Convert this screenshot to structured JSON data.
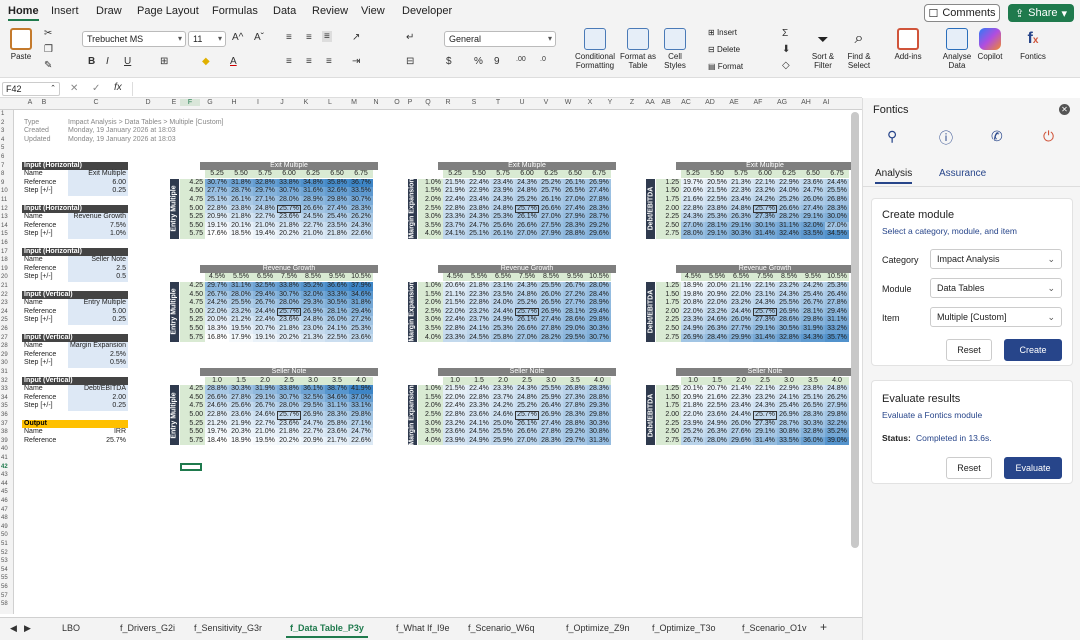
{
  "menu": {
    "tabs": [
      "Home",
      "Insert",
      "Draw",
      "Page Layout",
      "Formulas",
      "Data",
      "Review",
      "View",
      "Developer"
    ],
    "comments": "Comments",
    "share": "Share"
  },
  "ribbon": {
    "paste": "Paste",
    "font_name": "Trebuchet MS",
    "font_size": "11",
    "number_format": "General",
    "cond_fmt": "Conditional Formatting",
    "format_table": "Format as Table",
    "cell_styles": "Cell Styles",
    "insert": "Insert",
    "delete": "Delete",
    "format": "Format",
    "sort_filter": "Sort & Filter",
    "find_select": "Find & Select",
    "addins": "Add-ins",
    "analyse": "Analyse Data",
    "copilot": "Copilot",
    "fontics": "Fontics"
  },
  "formula_bar": {
    "name_box": "F42",
    "fx": "fx",
    "formula": ""
  },
  "columns": [
    "A",
    "B",
    "C",
    "D",
    "E",
    "F",
    "G",
    "H",
    "I",
    "J",
    "K",
    "L",
    "M",
    "N",
    "O",
    "P",
    "Q",
    "R",
    "S",
    "T",
    "U",
    "V",
    "W",
    "X",
    "Y",
    "Z",
    "AA",
    "AB",
    "AC",
    "AD",
    "AE",
    "AF",
    "AG",
    "AH",
    "AI"
  ],
  "meta": [
    {
      "label": "Type",
      "value": "Impact Analysis > Data Tables > Multiple [Custom]"
    },
    {
      "label": "Created",
      "value": "Monday, 19 January 2026 at 18:03"
    },
    {
      "label": "Updated",
      "value": "Monday, 19 January 2026 at 18:03"
    }
  ],
  "inputs": [
    {
      "header": "Input (Horizontal)",
      "rows": [
        [
          "Name",
          "Exit Multiple"
        ],
        [
          "Reference",
          "6.00"
        ],
        [
          "Step [+/-]",
          "0.25"
        ]
      ]
    },
    {
      "header": "Input (Horizontal)",
      "rows": [
        [
          "Name",
          "Revenue Growth"
        ],
        [
          "Reference",
          "7.5%"
        ],
        [
          "Step [+/-]",
          "1.0%"
        ]
      ]
    },
    {
      "header": "Input (Horizontal)",
      "rows": [
        [
          "Name",
          "Seller Note"
        ],
        [
          "Reference",
          "2.5"
        ],
        [
          "Step [+/-]",
          "0.5"
        ]
      ]
    },
    {
      "header": "Input (Vertical)",
      "rows": [
        [
          "Name",
          "Entry Multiple"
        ],
        [
          "Reference",
          "5.00"
        ],
        [
          "Step [+/-]",
          "0.25"
        ]
      ]
    },
    {
      "header": "Input (Vertical)",
      "rows": [
        [
          "Name",
          "Margin Expansion"
        ],
        [
          "Reference",
          "2.5%"
        ],
        [
          "Step [+/-]",
          "0.5%"
        ]
      ]
    },
    {
      "header": "Input (Vertical)",
      "rows": [
        [
          "Name",
          "Debt/EBITDA"
        ],
        [
          "Reference",
          "2.00"
        ],
        [
          "Step [+/-]",
          "0.25"
        ]
      ]
    }
  ],
  "output": {
    "header": "Output",
    "rows": [
      [
        "Name",
        "IRR"
      ],
      [
        "Reference",
        "25.7%"
      ]
    ]
  },
  "table_groups": [
    {
      "title": "Exit Multiple",
      "cols": [
        "5.25",
        "5.50",
        "5.75",
        "6.00",
        "6.25",
        "6.50",
        "6.75"
      ]
    },
    {
      "title": "Revenue Growth",
      "cols": [
        "4.5%",
        "5.5%",
        "6.5%",
        "7.5%",
        "8.5%",
        "9.5%",
        "10.5%"
      ]
    },
    {
      "title": "Seller Note",
      "cols": [
        "1.0",
        "1.5",
        "2.0",
        "2.5",
        "3.0",
        "3.5",
        "4.0"
      ]
    }
  ],
  "row_inputs": [
    {
      "label": "Entry Multiple",
      "rows": [
        "4.25",
        "4.50",
        "4.75",
        "5.00",
        "5.25",
        "5.50",
        "5.75"
      ]
    },
    {
      "label": "Margin Expansion",
      "rows": [
        "1.0%",
        "1.5%",
        "2.0%",
        "2.5%",
        "3.0%",
        "3.5%",
        "4.0%"
      ]
    },
    {
      "label": "Debt/EBITDA",
      "rows": [
        "1.25",
        "1.50",
        "1.75",
        "2.00",
        "2.25",
        "2.50",
        "2.75"
      ]
    }
  ],
  "tables": [
    [
      [
        [
          "30.7%",
          "31.8%",
          "32.8%",
          "33.8%",
          "34.8%",
          "35.8%",
          "36.7%"
        ],
        [
          "27.7%",
          "28.7%",
          "29.7%",
          "30.7%",
          "31.6%",
          "32.6%",
          "33.5%"
        ],
        [
          "25.1%",
          "26.1%",
          "27.1%",
          "28.0%",
          "28.9%",
          "29.8%",
          "30.7%"
        ],
        [
          "22.8%",
          "23.8%",
          "24.8%",
          "25.7%",
          "26.6%",
          "27.4%",
          "28.3%"
        ],
        [
          "20.9%",
          "21.8%",
          "22.7%",
          "23.6%",
          "24.5%",
          "25.4%",
          "26.2%"
        ],
        [
          "19.1%",
          "20.1%",
          "21.0%",
          "21.8%",
          "22.7%",
          "23.5%",
          "24.3%"
        ],
        [
          "17.6%",
          "18.5%",
          "19.4%",
          "20.2%",
          "21.0%",
          "21.8%",
          "22.6%"
        ]
      ],
      [
        [
          "21.5%",
          "22.4%",
          "23.4%",
          "24.3%",
          "25.2%",
          "26.1%",
          "26.9%"
        ],
        [
          "21.9%",
          "22.9%",
          "23.9%",
          "24.8%",
          "25.7%",
          "26.5%",
          "27.4%"
        ],
        [
          "22.4%",
          "23.4%",
          "24.3%",
          "25.2%",
          "26.1%",
          "27.0%",
          "27.8%"
        ],
        [
          "22.8%",
          "23.8%",
          "24.8%",
          "25.7%",
          "26.6%",
          "27.4%",
          "28.3%"
        ],
        [
          "23.3%",
          "24.3%",
          "25.3%",
          "26.1%",
          "27.0%",
          "27.9%",
          "28.7%"
        ],
        [
          "23.7%",
          "24.7%",
          "25.6%",
          "26.6%",
          "27.5%",
          "28.3%",
          "29.2%"
        ],
        [
          "24.1%",
          "25.1%",
          "26.1%",
          "27.0%",
          "27.9%",
          "28.8%",
          "29.6%"
        ]
      ],
      [
        [
          "19.7%",
          "20.5%",
          "21.3%",
          "22.1%",
          "22.9%",
          "23.6%",
          "24.4%"
        ],
        [
          "20.6%",
          "21.5%",
          "22.3%",
          "23.2%",
          "24.0%",
          "24.7%",
          "25.5%"
        ],
        [
          "21.6%",
          "22.5%",
          "23.4%",
          "24.2%",
          "25.2%",
          "26.0%",
          "26.8%"
        ],
        [
          "22.8%",
          "23.8%",
          "24.8%",
          "25.7%",
          "26.6%",
          "27.4%",
          "28.3%"
        ],
        [
          "24.3%",
          "25.3%",
          "26.3%",
          "27.3%",
          "28.2%",
          "29.1%",
          "30.0%"
        ],
        [
          "27.0%",
          "28.1%",
          "29.1%",
          "30.1%",
          "31.1%",
          "32.0%",
          "27.0%"
        ],
        [
          "28.0%",
          "29.1%",
          "30.3%",
          "31.4%",
          "32.4%",
          "33.5%",
          "34.5%"
        ]
      ]
    ],
    [
      [
        [
          "29.7%",
          "31.1%",
          "32.5%",
          "33.8%",
          "35.2%",
          "36.6%",
          "37.9%"
        ],
        [
          "26.7%",
          "28.0%",
          "29.4%",
          "30.7%",
          "32.0%",
          "33.3%",
          "34.6%"
        ],
        [
          "24.2%",
          "25.5%",
          "26.7%",
          "28.0%",
          "29.3%",
          "30.5%",
          "31.8%"
        ],
        [
          "22.0%",
          "23.2%",
          "24.4%",
          "25.7%",
          "26.9%",
          "28.1%",
          "29.4%"
        ],
        [
          "20.0%",
          "21.2%",
          "22.4%",
          "23.6%",
          "24.8%",
          "26.0%",
          "27.2%"
        ],
        [
          "18.3%",
          "19.5%",
          "20.7%",
          "21.8%",
          "23.0%",
          "24.1%",
          "25.3%"
        ],
        [
          "16.8%",
          "17.9%",
          "19.1%",
          "20.2%",
          "21.3%",
          "22.5%",
          "23.6%"
        ]
      ],
      [
        [
          "20.6%",
          "21.8%",
          "23.1%",
          "24.3%",
          "25.5%",
          "26.7%",
          "28.0%"
        ],
        [
          "21.1%",
          "22.3%",
          "23.5%",
          "24.8%",
          "26.0%",
          "27.2%",
          "28.4%"
        ],
        [
          "21.5%",
          "22.8%",
          "24.0%",
          "25.2%",
          "26.5%",
          "27.7%",
          "28.9%"
        ],
        [
          "22.0%",
          "23.2%",
          "24.4%",
          "25.7%",
          "26.9%",
          "28.1%",
          "29.4%"
        ],
        [
          "22.4%",
          "23.7%",
          "24.9%",
          "26.1%",
          "27.4%",
          "28.6%",
          "29.8%"
        ],
        [
          "22.8%",
          "24.1%",
          "25.3%",
          "26.6%",
          "27.8%",
          "29.0%",
          "30.3%"
        ],
        [
          "23.3%",
          "24.5%",
          "25.8%",
          "27.0%",
          "28.2%",
          "29.5%",
          "30.7%"
        ]
      ],
      [
        [
          "18.9%",
          "20.0%",
          "21.1%",
          "22.1%",
          "23.2%",
          "24.2%",
          "25.3%"
        ],
        [
          "19.8%",
          "20.9%",
          "22.0%",
          "23.1%",
          "24.3%",
          "25.4%",
          "26.4%"
        ],
        [
          "20.8%",
          "22.0%",
          "23.2%",
          "24.3%",
          "25.5%",
          "26.7%",
          "27.8%"
        ],
        [
          "22.0%",
          "23.2%",
          "24.4%",
          "25.7%",
          "26.9%",
          "28.1%",
          "29.4%"
        ],
        [
          "23.3%",
          "24.6%",
          "26.0%",
          "27.3%",
          "28.6%",
          "29.8%",
          "31.1%"
        ],
        [
          "24.9%",
          "26.3%",
          "27.7%",
          "29.1%",
          "30.5%",
          "31.9%",
          "33.2%"
        ],
        [
          "26.9%",
          "28.4%",
          "29.9%",
          "31.4%",
          "32.8%",
          "34.3%",
          "35.7%"
        ]
      ]
    ],
    [
      [
        [
          "28.8%",
          "30.3%",
          "31.9%",
          "33.8%",
          "36.1%",
          "38.7%",
          "41.9%"
        ],
        [
          "26.6%",
          "27.8%",
          "29.1%",
          "30.7%",
          "32.5%",
          "34.6%",
          "37.0%"
        ],
        [
          "24.6%",
          "25.6%",
          "26.7%",
          "28.0%",
          "29.5%",
          "31.1%",
          "33.1%"
        ],
        [
          "22.8%",
          "23.6%",
          "24.6%",
          "25.7%",
          "26.9%",
          "28.3%",
          "29.8%"
        ],
        [
          "21.2%",
          "21.9%",
          "22.7%",
          "23.6%",
          "24.7%",
          "25.8%",
          "27.1%"
        ],
        [
          "19.7%",
          "20.3%",
          "21.0%",
          "21.8%",
          "22.7%",
          "23.6%",
          "24.7%"
        ],
        [
          "18.4%",
          "18.9%",
          "19.5%",
          "20.2%",
          "20.9%",
          "21.7%",
          "22.6%"
        ]
      ],
      [
        [
          "21.5%",
          "22.4%",
          "23.3%",
          "24.3%",
          "25.5%",
          "26.8%",
          "28.3%"
        ],
        [
          "22.0%",
          "22.8%",
          "23.7%",
          "24.8%",
          "25.9%",
          "27.3%",
          "28.8%"
        ],
        [
          "22.4%",
          "23.3%",
          "24.2%",
          "25.2%",
          "26.4%",
          "27.8%",
          "29.3%"
        ],
        [
          "22.8%",
          "23.6%",
          "24.6%",
          "25.7%",
          "26.9%",
          "28.3%",
          "29.8%"
        ],
        [
          "23.2%",
          "24.1%",
          "25.0%",
          "26.1%",
          "27.4%",
          "28.8%",
          "30.3%"
        ],
        [
          "23.6%",
          "24.5%",
          "25.5%",
          "26.6%",
          "27.8%",
          "29.2%",
          "30.8%"
        ],
        [
          "23.9%",
          "24.9%",
          "25.9%",
          "27.0%",
          "28.3%",
          "29.7%",
          "31.3%"
        ]
      ],
      [
        [
          "20.1%",
          "20.7%",
          "21.4%",
          "22.1%",
          "22.9%",
          "23.8%",
          "24.8%"
        ],
        [
          "20.9%",
          "21.6%",
          "22.3%",
          "23.2%",
          "24.1%",
          "25.1%",
          "26.2%"
        ],
        [
          "21.8%",
          "22.5%",
          "23.4%",
          "24.3%",
          "25.4%",
          "26.5%",
          "27.9%"
        ],
        [
          "22.0%",
          "23.6%",
          "24.4%",
          "25.7%",
          "26.9%",
          "28.3%",
          "29.8%"
        ],
        [
          "23.9%",
          "24.9%",
          "26.0%",
          "27.3%",
          "28.7%",
          "30.3%",
          "32.2%"
        ],
        [
          "25.2%",
          "26.3%",
          "27.6%",
          "29.1%",
          "30.8%",
          "32.8%",
          "35.2%"
        ],
        [
          "26.7%",
          "28.0%",
          "29.6%",
          "31.4%",
          "33.5%",
          "36.0%",
          "39.0%"
        ]
      ]
    ]
  ],
  "active_cell": "F42",
  "sheet_tabs": [
    "LBO",
    "f_Drivers_G2i",
    "f_Sensitivity_G3r",
    "f_Data Table_P3y",
    "f_What If_I9e",
    "f_Scenario_W6q",
    "f_Optimize_Z9n",
    "f_Optimize_T3o",
    "f_Scenario_O1v"
  ],
  "active_sheet": "f_Data Table_P3y",
  "pane": {
    "title": "Fontics",
    "tabs": [
      "Analysis",
      "Assurance"
    ],
    "create": {
      "title": "Create module",
      "subtitle": "Select a category, module, and item",
      "fields": [
        {
          "label": "Category",
          "value": "Impact Analysis"
        },
        {
          "label": "Module",
          "value": "Data Tables"
        },
        {
          "label": "Item",
          "value": "Multiple [Custom]"
        }
      ],
      "reset": "Reset",
      "create": "Create"
    },
    "evaluate": {
      "title": "Evaluate results",
      "subtitle": "Evaluate a Fontics module",
      "status_label": "Status:",
      "status_value": "Completed in 13.6s.",
      "reset": "Reset",
      "evaluate": "Evaluate"
    }
  },
  "colors": {
    "accent": "#1f7a4d",
    "primary_button": "#27458a",
    "heat_low": "#ffffff",
    "heat_high": "#3d85c6"
  }
}
